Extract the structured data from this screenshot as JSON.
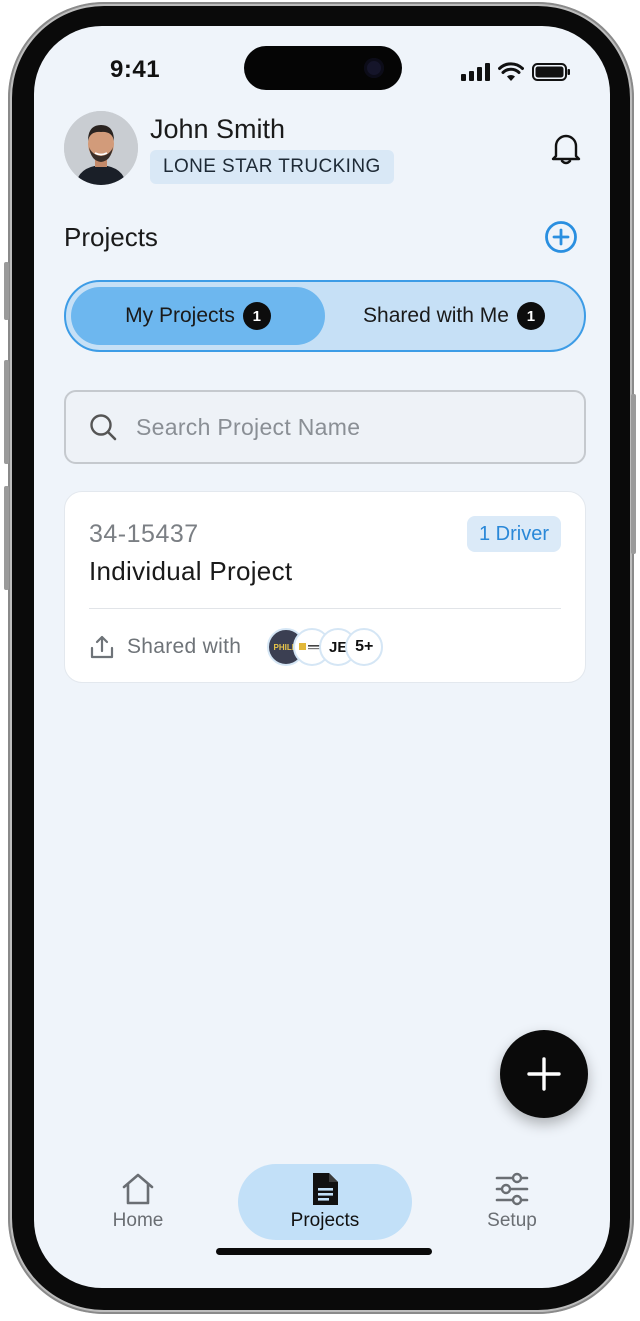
{
  "status_bar": {
    "time": "9:41"
  },
  "header": {
    "user_name": "John Smith",
    "company": "LONE STAR TRUCKING"
  },
  "projects_section": {
    "title": "Projects",
    "tabs": [
      {
        "label": "My Projects",
        "count": "1",
        "active": true
      },
      {
        "label": "Shared with Me",
        "count": "1",
        "active": false
      }
    ]
  },
  "search": {
    "placeholder": "Search Project Name"
  },
  "project_card": {
    "number": "34-15437",
    "name": "Individual Project",
    "driver_badge": "1 Driver",
    "shared_label": "Shared with",
    "logos": [
      "PHILLI",
      "",
      "JE"
    ],
    "more_count": "5+"
  },
  "bottom_nav": {
    "items": [
      {
        "label": "Home",
        "icon": "home-icon"
      },
      {
        "label": "Projects",
        "icon": "document-icon",
        "active": true
      },
      {
        "label": "Setup",
        "icon": "sliders-icon"
      }
    ]
  },
  "colors": {
    "accent": "#3d9ce6",
    "active_tab": "#6db7ef",
    "background": "#eff4fa"
  }
}
